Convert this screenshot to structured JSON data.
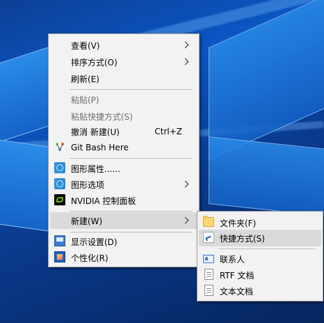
{
  "context_menu": {
    "items": [
      {
        "label": "查看(V)",
        "submenu": true
      },
      {
        "label": "排序方式(O)",
        "submenu": true
      },
      {
        "label": "刷新(E)"
      },
      {
        "label": "粘贴(P)",
        "disabled": true
      },
      {
        "label": "粘贴快捷方式(S)",
        "disabled": true
      },
      {
        "label": "撤消 新建(U)",
        "shortcut": "Ctrl+Z"
      },
      {
        "label": "Git Bash Here",
        "icon": "git-icon"
      },
      {
        "label": "图形属性......",
        "icon": "intel-graphics-icon"
      },
      {
        "label": "图形选项",
        "icon": "intel-graphics-icon",
        "submenu": true
      },
      {
        "label": "NVIDIA 控制面板",
        "icon": "nvidia-icon"
      },
      {
        "label": "新建(W)",
        "submenu": true,
        "highlighted": true
      },
      {
        "label": "显示设置(D)",
        "icon": "display-icon"
      },
      {
        "label": "个性化(R)",
        "icon": "personalize-icon"
      }
    ]
  },
  "new_submenu": {
    "items": [
      {
        "label": "文件夹(F)",
        "icon": "folder-icon"
      },
      {
        "label": "快捷方式(S)",
        "icon": "shortcut-icon",
        "highlighted": true
      },
      {
        "label": "联系人",
        "icon": "contact-icon"
      },
      {
        "label": "RTF 文档",
        "icon": "rtf-document-icon"
      },
      {
        "label": "文本文档",
        "icon": "text-document-icon"
      }
    ]
  },
  "colors": {
    "menu_bg": "#f2f2f2",
    "highlight": "#dadada",
    "disabled_text": "#6d6d6d"
  }
}
